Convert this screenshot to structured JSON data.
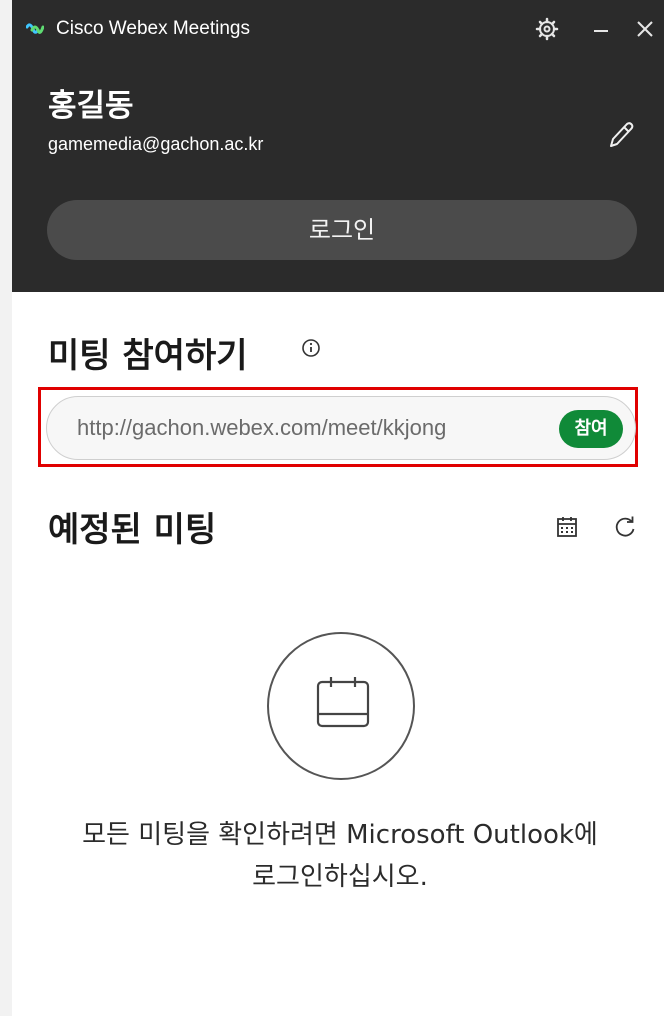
{
  "titlebar": {
    "app_title": "Cisco Webex Meetings",
    "settings_icon": "gear-icon",
    "minimize_icon": "minimize-icon",
    "close_icon": "close-icon"
  },
  "profile": {
    "name": "홍길동",
    "email": "gamemedia@gachon.ac.kr",
    "edit_icon": "pencil-icon",
    "login_label": "로그인"
  },
  "join": {
    "title": "미팅 참여하기",
    "info_icon": "info-icon",
    "url_value": "http://gachon.webex.com/meet/kkjong",
    "join_label": "참여",
    "join_color": "#108a38"
  },
  "scheduled": {
    "title": "예정된 미팅",
    "calendar_icon": "calendar-icon",
    "refresh_icon": "refresh-icon",
    "empty_icon": "calendar-icon",
    "empty_line1": "모든 미팅을 확인하려면 Microsoft Outlook에",
    "empty_line2": "로그인하십시오."
  },
  "colors": {
    "dark_panel": "#2b2b2b",
    "highlight": "#e00000"
  }
}
